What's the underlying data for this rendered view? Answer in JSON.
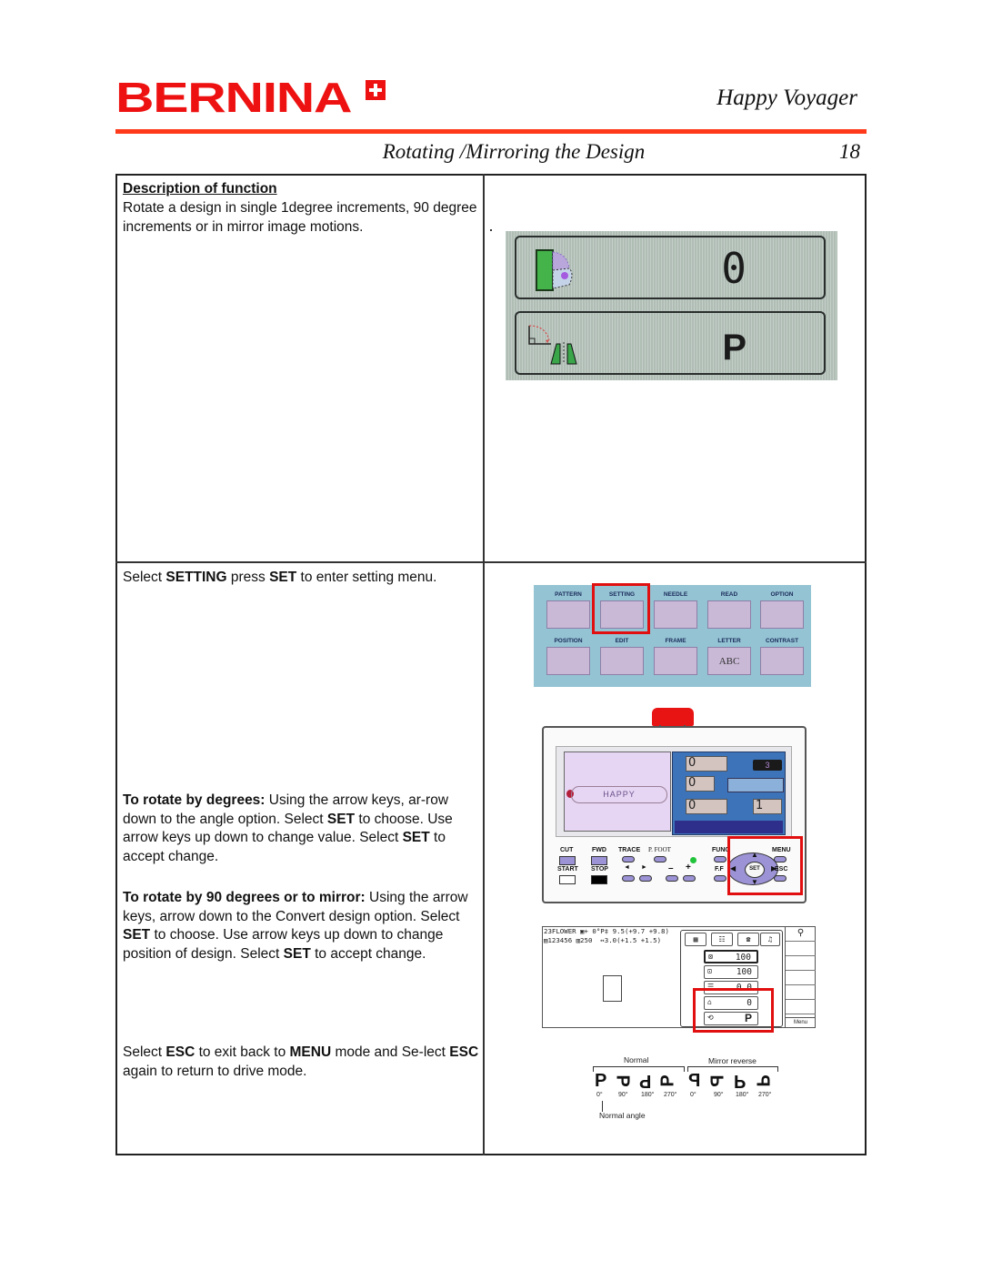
{
  "header": {
    "brand": "BERNINA",
    "brand_color": "#ee1111",
    "product": "Happy Voyager",
    "accent_rule_color": "#ff3a1a",
    "section_title": "Rotating /Mirroring the Design",
    "page_number": "18"
  },
  "rows": {
    "description": {
      "heading": "Description of function",
      "body": "Rotate a design in single 1degree increments,  90 degree increments or in mirror image motions."
    },
    "lcd_closeup": {
      "angle_value": "0",
      "convert_value": "P",
      "icons": [
        "rotate-angle-icon",
        "convert-mirror-icon"
      ]
    },
    "instructions": {
      "select_setting": {
        "pre": "Select ",
        "b1": "SETTING",
        "mid": " press ",
        "b2": "SET",
        "post": " to enter setting menu."
      },
      "rotate_degrees": {
        "lead": "To rotate by degrees:",
        "t1": " Using the arrow keys, ar-row down to the angle option. Select ",
        "b1": "SET",
        "t2": " to choose. Use arrow keys up down to change value. Select ",
        "b2": "SET",
        "t3": " to accept change."
      },
      "rotate_90": {
        "lead": "To rotate by 90 degrees or to mirror:",
        "t1": " Using the arrow keys, arrow down to the Convert design option. Select ",
        "b1": "SET",
        "t2": " to choose. Use arrow keys up down to change position of design. Select ",
        "b2": "SET",
        "t3": " to accept change."
      },
      "exit": {
        "pre": "Select ",
        "b1": "ESC",
        "t1": " to exit back to ",
        "b2": "MENU",
        "t2": " mode and Se-lect ",
        "b3": "ESC",
        "t3": " again to return to drive mode."
      }
    },
    "menu_screen": {
      "items": [
        {
          "label": "PATTERN",
          "icon": "pattern-icon"
        },
        {
          "label": "SETTING",
          "icon": "setting-icon",
          "highlighted": true
        },
        {
          "label": "NEEDLE",
          "icon": "needle-icon"
        },
        {
          "label": "READ",
          "icon": "read-icon"
        },
        {
          "label": "OPTION",
          "icon": "option-icon"
        },
        {
          "label": "POSITION",
          "icon": "position-icon"
        },
        {
          "label": "EDIT",
          "icon": "edit-icon"
        },
        {
          "label": "FRAME",
          "icon": "frame-icon"
        },
        {
          "label": "LETTER",
          "icon": "letter-icon",
          "glyph": "ABC"
        },
        {
          "label": "CONTRAST",
          "icon": "contrast-icon"
        }
      ]
    },
    "control_panel": {
      "lcd_design_name": "HAPPY",
      "fields": [
        "0",
        "0",
        "0",
        "1"
      ],
      "dark_field": "3",
      "buttons": {
        "cut": "CUT",
        "fwd": "FWD",
        "trace": "TRACE",
        "pfoot": "P. FOOT",
        "func": "FUNC",
        "menu": "MENU",
        "start": "START",
        "stop": "STOP",
        "ff": "F.F",
        "set": "SET",
        "esc": "ESC",
        "left": "◄",
        "right": "►",
        "minus": "–",
        "plus": "+"
      }
    },
    "settings_screen": {
      "info_line1": "23FLOWER ▣+ 0°P‡ 9.5(+9.7 +9.8)",
      "info_line2": "▤123456 ▥250  ↔3.0(+1.5 +1.5)",
      "rows": [
        {
          "icon": "scale-x-icon",
          "value": "100"
        },
        {
          "icon": "scale-y-icon",
          "value": "100"
        },
        {
          "icon": "density-icon",
          "value": "0.0"
        },
        {
          "icon": "angle-icon",
          "value": "0"
        },
        {
          "icon": "convert-icon",
          "value": "P"
        }
      ],
      "side_label": "Menu"
    },
    "orientation_diagram": {
      "normal_label": "Normal",
      "mirror_label": "Mirror reverse",
      "normal_angle_label": "Normal angle",
      "glyphs": [
        "P",
        "ᗡ",
        "d",
        "Ⴄ",
        "q",
        "Ⴄ",
        "b",
        "ᗡ"
      ],
      "degrees": [
        "0°",
        "90°",
        "180°",
        "270°",
        "0°",
        "90°",
        "180°",
        "270°"
      ]
    }
  }
}
